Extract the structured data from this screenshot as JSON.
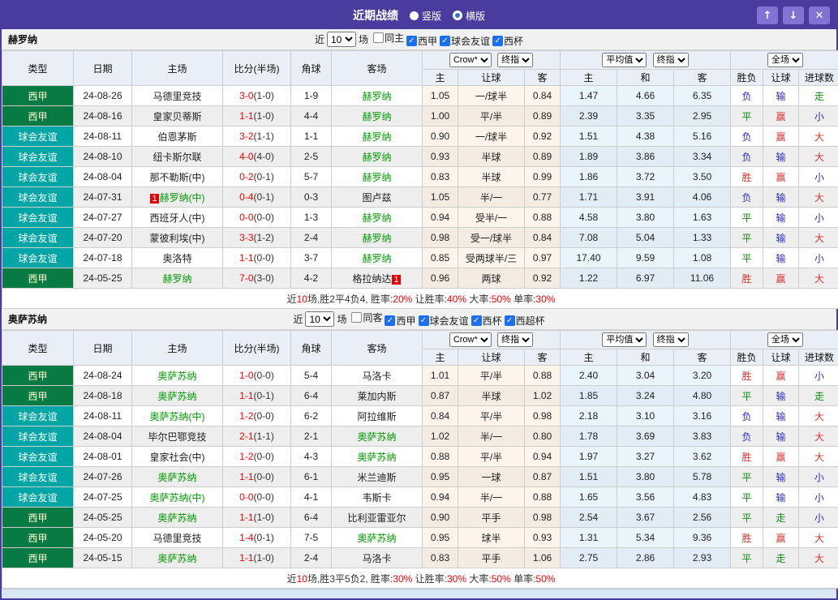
{
  "header": {
    "title": "近期战绩",
    "radios": [
      {
        "label": "竖版",
        "selected": true
      },
      {
        "label": "横版",
        "selected": false
      }
    ],
    "buttons": {
      "up": "↑",
      "down": "↓",
      "close": "✕"
    }
  },
  "colors": {
    "titlebar": "#4a3b9f",
    "title_button": "#8172d4",
    "liga_bg": "#087b45",
    "friendly_bg": "#00a5a5",
    "score_red": "#ff0000",
    "team_green": "#009900",
    "win_red": "#dd342e",
    "draw_green": "#0f8a0f",
    "lose_blue": "#2a2ad0"
  },
  "tables": [
    {
      "team": "赫罗纳",
      "filter": {
        "prefix": "近",
        "count": "10",
        "suffix": "场",
        "checkboxes": [
          {
            "label": "同主",
            "checked": false
          },
          {
            "label": "西甲",
            "checked": true
          },
          {
            "label": "球会友谊",
            "checked": true
          },
          {
            "label": "西杯",
            "checked": true
          }
        ]
      },
      "selects": {
        "provider": "Crow*",
        "provider_time": "终指",
        "europe": "平均值",
        "europe_time": "终指",
        "scope": "全场"
      },
      "columns": [
        "类型",
        "日期",
        "主场",
        "比分(半场)",
        "角球",
        "客场"
      ],
      "subcolumns": [
        "主",
        "让球",
        "客",
        "主",
        "和",
        "客",
        "胜负",
        "让球",
        "进球数"
      ],
      "rows": [
        {
          "type": "西甲",
          "tstyle": "liga",
          "date": "24-08-26",
          "home": {
            "name": "马德里竞技"
          },
          "score": "3-0",
          "half": "(1-0)",
          "corner": "1-9",
          "away": {
            "name": "赫罗纳",
            "hl": true
          },
          "odds": [
            "1.05",
            "一/球半",
            "0.84"
          ],
          "avg": [
            "1.47",
            "4.66",
            "6.35"
          ],
          "res": [
            [
              "负",
              "b"
            ],
            [
              "输",
              "b"
            ],
            [
              "走",
              "g"
            ]
          ]
        },
        {
          "type": "西甲",
          "tstyle": "liga",
          "date": "24-08-16",
          "home": {
            "name": "皇家贝蒂斯"
          },
          "score": "1-1",
          "half": "(1-0)",
          "corner": "4-4",
          "away": {
            "name": "赫罗纳",
            "hl": true
          },
          "odds": [
            "1.00",
            "平/半",
            "0.89"
          ],
          "avg": [
            "2.39",
            "3.35",
            "2.95"
          ],
          "res": [
            [
              "平",
              "g"
            ],
            [
              "赢",
              "r"
            ],
            [
              "小",
              "b"
            ]
          ]
        },
        {
          "type": "球会友谊",
          "tstyle": "friendly",
          "date": "24-08-11",
          "home": {
            "name": "伯恩茅斯"
          },
          "score": "3-2",
          "half": "(1-1)",
          "corner": "1-1",
          "away": {
            "name": "赫罗纳",
            "hl": true
          },
          "odds": [
            "0.90",
            "一/球半",
            "0.92"
          ],
          "avg": [
            "1.51",
            "4.38",
            "5.16"
          ],
          "res": [
            [
              "负",
              "b"
            ],
            [
              "赢",
              "r"
            ],
            [
              "大",
              "r"
            ]
          ]
        },
        {
          "type": "球会友谊",
          "tstyle": "friendly",
          "date": "24-08-10",
          "home": {
            "name": "纽卡斯尔联"
          },
          "score": "4-0",
          "half": "(4-0)",
          "corner": "2-5",
          "away": {
            "name": "赫罗纳",
            "hl": true
          },
          "odds": [
            "0.93",
            "半球",
            "0.89"
          ],
          "avg": [
            "1.89",
            "3.86",
            "3.34"
          ],
          "res": [
            [
              "负",
              "b"
            ],
            [
              "输",
              "b"
            ],
            [
              "大",
              "r"
            ]
          ]
        },
        {
          "type": "球会友谊",
          "tstyle": "friendly",
          "date": "24-08-04",
          "home": {
            "name": "那不勒斯(中)"
          },
          "score": "0-2",
          "half": "(0-1)",
          "corner": "5-7",
          "away": {
            "name": "赫罗纳",
            "hl": true
          },
          "odds": [
            "0.83",
            "半球",
            "0.99"
          ],
          "avg": [
            "1.86",
            "3.72",
            "3.50"
          ],
          "res": [
            [
              "胜",
              "r"
            ],
            [
              "赢",
              "r"
            ],
            [
              "小",
              "b"
            ]
          ]
        },
        {
          "type": "球会友谊",
          "tstyle": "friendly",
          "date": "24-07-31",
          "home": {
            "name": "赫罗纳(中)",
            "hl": true,
            "badge_before": "1"
          },
          "score": "0-4",
          "half": "(0-1)",
          "corner": "0-3",
          "away": {
            "name": "图卢兹"
          },
          "odds": [
            "1.05",
            "半/一",
            "0.77"
          ],
          "avg": [
            "1.71",
            "3.91",
            "4.06"
          ],
          "res": [
            [
              "负",
              "b"
            ],
            [
              "输",
              "b"
            ],
            [
              "大",
              "r"
            ]
          ]
        },
        {
          "type": "球会友谊",
          "tstyle": "friendly",
          "date": "24-07-27",
          "home": {
            "name": "西班牙人(中)"
          },
          "score": "0-0",
          "half": "(0-0)",
          "corner": "1-3",
          "away": {
            "name": "赫罗纳",
            "hl": true
          },
          "odds": [
            "0.94",
            "受半/一",
            "0.88"
          ],
          "avg": [
            "4.58",
            "3.80",
            "1.63"
          ],
          "res": [
            [
              "平",
              "g"
            ],
            [
              "输",
              "b"
            ],
            [
              "小",
              "b"
            ]
          ]
        },
        {
          "type": "球会友谊",
          "tstyle": "friendly",
          "date": "24-07-20",
          "home": {
            "name": "蒙彼利埃(中)"
          },
          "score": "3-3",
          "half": "(1-2)",
          "corner": "2-4",
          "away": {
            "name": "赫罗纳",
            "hl": true
          },
          "odds": [
            "0.98",
            "受一/球半",
            "0.84"
          ],
          "avg": [
            "7.08",
            "5.04",
            "1.33"
          ],
          "res": [
            [
              "平",
              "g"
            ],
            [
              "输",
              "b"
            ],
            [
              "大",
              "r"
            ]
          ]
        },
        {
          "type": "球会友谊",
          "tstyle": "friendly",
          "date": "24-07-18",
          "home": {
            "name": "奥洛特"
          },
          "score": "1-1",
          "half": "(0-0)",
          "corner": "3-7",
          "away": {
            "name": "赫罗纳",
            "hl": true
          },
          "odds": [
            "0.85",
            "受两球半/三",
            "0.97"
          ],
          "avg": [
            "17.40",
            "9.59",
            "1.08"
          ],
          "res": [
            [
              "平",
              "g"
            ],
            [
              "输",
              "b"
            ],
            [
              "小",
              "b"
            ]
          ]
        },
        {
          "type": "西甲",
          "tstyle": "liga",
          "date": "24-05-25",
          "home": {
            "name": "赫罗纳",
            "hl": true
          },
          "score": "7-0",
          "half": "(3-0)",
          "corner": "4-2",
          "away": {
            "name": "格拉纳达",
            "badge_after": "1"
          },
          "odds": [
            "0.96",
            "两球",
            "0.92"
          ],
          "avg": [
            "1.22",
            "6.97",
            "11.06"
          ],
          "res": [
            [
              "胜",
              "r"
            ],
            [
              "赢",
              "r"
            ],
            [
              "大",
              "r"
            ]
          ]
        }
      ],
      "summary": [
        {
          "text": "近"
        },
        {
          "text": "10",
          "red": true
        },
        {
          "text": "场,胜2平4负4, 胜率:"
        },
        {
          "text": "20%",
          "red": true
        },
        {
          "text": " 让胜率:"
        },
        {
          "text": "40%",
          "red": true
        },
        {
          "text": " 大率:"
        },
        {
          "text": "50%",
          "red": true
        },
        {
          "text": " 单率:"
        },
        {
          "text": "30%",
          "red": true
        }
      ]
    },
    {
      "team": "奥萨苏纳",
      "filter": {
        "prefix": "近",
        "count": "10",
        "suffix": "场",
        "checkboxes": [
          {
            "label": "同客",
            "checked": false
          },
          {
            "label": "西甲",
            "checked": true
          },
          {
            "label": "球会友谊",
            "checked": true
          },
          {
            "label": "西杯",
            "checked": true
          },
          {
            "label": "西超杯",
            "checked": true
          }
        ]
      },
      "selects": {
        "provider": "Crow*",
        "provider_time": "终指",
        "europe": "平均值",
        "europe_time": "终指",
        "scope": "全场"
      },
      "columns": [
        "类型",
        "日期",
        "主场",
        "比分(半场)",
        "角球",
        "客场"
      ],
      "subcolumns": [
        "主",
        "让球",
        "客",
        "主",
        "和",
        "客",
        "胜负",
        "让球",
        "进球数"
      ],
      "rows": [
        {
          "type": "西甲",
          "tstyle": "liga",
          "date": "24-08-24",
          "home": {
            "name": "奥萨苏纳",
            "hl": true
          },
          "score": "1-0",
          "half": "(0-0)",
          "corner": "5-4",
          "away": {
            "name": "马洛卡"
          },
          "odds": [
            "1.01",
            "平/半",
            "0.88"
          ],
          "avg": [
            "2.40",
            "3.04",
            "3.20"
          ],
          "res": [
            [
              "胜",
              "r"
            ],
            [
              "赢",
              "r"
            ],
            [
              "小",
              "b"
            ]
          ]
        },
        {
          "type": "西甲",
          "tstyle": "liga",
          "date": "24-08-18",
          "home": {
            "name": "奥萨苏纳",
            "hl": true
          },
          "score": "1-1",
          "half": "(0-1)",
          "corner": "6-4",
          "away": {
            "name": "莱加内斯"
          },
          "odds": [
            "0.87",
            "半球",
            "1.02"
          ],
          "avg": [
            "1.85",
            "3.24",
            "4.80"
          ],
          "res": [
            [
              "平",
              "g"
            ],
            [
              "输",
              "b"
            ],
            [
              "走",
              "g"
            ]
          ]
        },
        {
          "type": "球会友谊",
          "tstyle": "friendly",
          "date": "24-08-11",
          "home": {
            "name": "奥萨苏纳(中)",
            "hl": true
          },
          "score": "1-2",
          "half": "(0-0)",
          "corner": "6-2",
          "away": {
            "name": "阿拉维斯"
          },
          "odds": [
            "0.84",
            "平/半",
            "0.98"
          ],
          "avg": [
            "2.18",
            "3.10",
            "3.16"
          ],
          "res": [
            [
              "负",
              "b"
            ],
            [
              "输",
              "b"
            ],
            [
              "大",
              "r"
            ]
          ]
        },
        {
          "type": "球会友谊",
          "tstyle": "friendly",
          "date": "24-08-04",
          "home": {
            "name": "毕尔巴鄂竞技"
          },
          "score": "2-1",
          "half": "(1-1)",
          "corner": "2-1",
          "away": {
            "name": "奥萨苏纳",
            "hl": true
          },
          "odds": [
            "1.02",
            "半/一",
            "0.80"
          ],
          "avg": [
            "1.78",
            "3.69",
            "3.83"
          ],
          "res": [
            [
              "负",
              "b"
            ],
            [
              "输",
              "b"
            ],
            [
              "大",
              "r"
            ]
          ]
        },
        {
          "type": "球会友谊",
          "tstyle": "friendly",
          "date": "24-08-01",
          "home": {
            "name": "皇家社会(中)"
          },
          "score": "1-2",
          "half": "(0-0)",
          "corner": "4-3",
          "away": {
            "name": "奥萨苏纳",
            "hl": true
          },
          "odds": [
            "0.88",
            "平/半",
            "0.94"
          ],
          "avg": [
            "1.97",
            "3.27",
            "3.62"
          ],
          "res": [
            [
              "胜",
              "r"
            ],
            [
              "赢",
              "r"
            ],
            [
              "大",
              "r"
            ]
          ]
        },
        {
          "type": "球会友谊",
          "tstyle": "friendly",
          "date": "24-07-26",
          "home": {
            "name": "奥萨苏纳",
            "hl": true
          },
          "score": "1-1",
          "half": "(0-0)",
          "corner": "6-1",
          "away": {
            "name": "米兰迪斯"
          },
          "odds": [
            "0.95",
            "一球",
            "0.87"
          ],
          "avg": [
            "1.51",
            "3.80",
            "5.78"
          ],
          "res": [
            [
              "平",
              "g"
            ],
            [
              "输",
              "b"
            ],
            [
              "小",
              "b"
            ]
          ]
        },
        {
          "type": "球会友谊",
          "tstyle": "friendly",
          "date": "24-07-25",
          "home": {
            "name": "奥萨苏纳(中)",
            "hl": true
          },
          "score": "0-0",
          "half": "(0-0)",
          "corner": "4-1",
          "away": {
            "name": "韦斯卡"
          },
          "odds": [
            "0.94",
            "半/一",
            "0.88"
          ],
          "avg": [
            "1.65",
            "3.56",
            "4.83"
          ],
          "res": [
            [
              "平",
              "g"
            ],
            [
              "输",
              "b"
            ],
            [
              "小",
              "b"
            ]
          ]
        },
        {
          "type": "西甲",
          "tstyle": "liga",
          "date": "24-05-25",
          "home": {
            "name": "奥萨苏纳",
            "hl": true
          },
          "score": "1-1",
          "half": "(1-0)",
          "corner": "6-4",
          "away": {
            "name": "比利亚雷亚尔"
          },
          "odds": [
            "0.90",
            "平手",
            "0.98"
          ],
          "avg": [
            "2.54",
            "3.67",
            "2.56"
          ],
          "res": [
            [
              "平",
              "g"
            ],
            [
              "走",
              "g"
            ],
            [
              "小",
              "b"
            ]
          ]
        },
        {
          "type": "西甲",
          "tstyle": "liga",
          "date": "24-05-20",
          "home": {
            "name": "马德里竞技"
          },
          "score": "1-4",
          "half": "(0-1)",
          "corner": "7-5",
          "away": {
            "name": "奥萨苏纳",
            "hl": true
          },
          "odds": [
            "0.95",
            "球半",
            "0.93"
          ],
          "avg": [
            "1.31",
            "5.34",
            "9.36"
          ],
          "res": [
            [
              "胜",
              "r"
            ],
            [
              "赢",
              "r"
            ],
            [
              "大",
              "r"
            ]
          ]
        },
        {
          "type": "西甲",
          "tstyle": "liga",
          "date": "24-05-15",
          "home": {
            "name": "奥萨苏纳",
            "hl": true
          },
          "score": "1-1",
          "half": "(1-0)",
          "corner": "2-4",
          "away": {
            "name": "马洛卡"
          },
          "odds": [
            "0.83",
            "平手",
            "1.06"
          ],
          "avg": [
            "2.75",
            "2.86",
            "2.93"
          ],
          "res": [
            [
              "平",
              "g"
            ],
            [
              "走",
              "g"
            ],
            [
              "大",
              "r"
            ]
          ]
        }
      ],
      "summary": [
        {
          "text": "近"
        },
        {
          "text": "10",
          "red": true
        },
        {
          "text": "场,胜3平5负2, 胜率:"
        },
        {
          "text": "30%",
          "red": true
        },
        {
          "text": " 让胜率:"
        },
        {
          "text": "30%",
          "red": true
        },
        {
          "text": " 大率:"
        },
        {
          "text": "50%",
          "red": true
        },
        {
          "text": " 单率:"
        },
        {
          "text": "50%",
          "red": true
        }
      ]
    }
  ]
}
